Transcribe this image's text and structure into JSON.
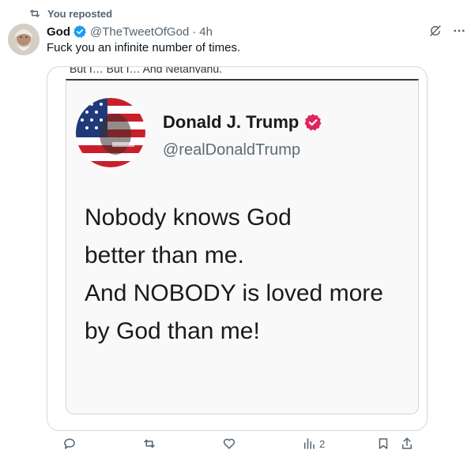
{
  "repost": {
    "label": "You reposted"
  },
  "post": {
    "author_name": "God",
    "handle": "@TheTweetOfGod",
    "dot": "·",
    "time": "4h",
    "text": "Fuck you an infinite number of times."
  },
  "media": {
    "cropped_caption": "But I… But I… And Netanyahu.",
    "quoted_name": "Donald J. Trump",
    "quoted_handle": "@realDonaldTrump",
    "quoted_lines": [
      "Nobody knows God",
      "better than me.",
      "And NOBODY is loved more",
      "by God than me!"
    ]
  },
  "actions": {
    "views_count": "2"
  },
  "colors": {
    "accent": "#1d9bf0",
    "muted": "#536471",
    "trump_badge": "#e0245e"
  }
}
